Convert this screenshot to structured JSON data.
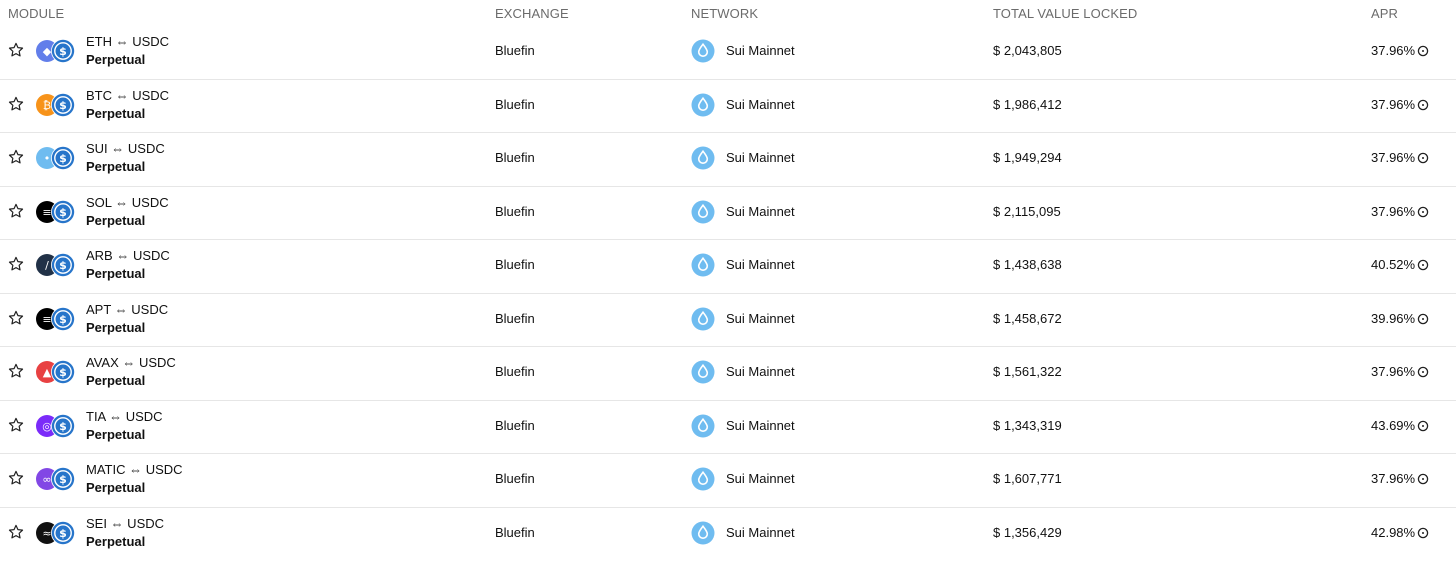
{
  "columns": {
    "module": "MODULE",
    "exchange": "EXCHANGE",
    "network": "NETWORK",
    "tvl": "TOTAL VALUE LOCKED",
    "apr": "APR"
  },
  "colors": {
    "usdc_blue": "#2775CA",
    "sui_blue": "#6FBCF0",
    "border": "#E6E6E6"
  },
  "icons": {
    "favorite": "star-outline-icon",
    "network": "sui-drop-icon",
    "apr_info": "info-circle-icon",
    "quote": "usdc-icon"
  },
  "rows": [
    {
      "pair": "ETH ⇔ USDC",
      "type": "Perpetual",
      "exchange": "Bluefin",
      "network": "Sui Mainnet",
      "tvl": "$ 2,043,805",
      "apr": "37.96%",
      "base_icon": "eth-icon",
      "base_color": "#627EEA"
    },
    {
      "pair": "BTC ⇔ USDC",
      "type": "Perpetual",
      "exchange": "Bluefin",
      "network": "Sui Mainnet",
      "tvl": "$ 1,986,412",
      "apr": "37.96%",
      "base_icon": "btc-icon",
      "base_color": "#F7931A"
    },
    {
      "pair": "SUI ⇔ USDC",
      "type": "Perpetual",
      "exchange": "Bluefin",
      "network": "Sui Mainnet",
      "tvl": "$ 1,949,294",
      "apr": "37.96%",
      "base_icon": "sui-icon",
      "base_color": "#6FBCF0"
    },
    {
      "pair": "SOL ⇔ USDC",
      "type": "Perpetual",
      "exchange": "Bluefin",
      "network": "Sui Mainnet",
      "tvl": "$ 2,115,095",
      "apr": "37.96%",
      "base_icon": "sol-icon",
      "base_color": "#000000"
    },
    {
      "pair": "ARB ⇔ USDC",
      "type": "Perpetual",
      "exchange": "Bluefin",
      "network": "Sui Mainnet",
      "tvl": "$ 1,438,638",
      "apr": "40.52%",
      "base_icon": "arb-icon",
      "base_color": "#213147"
    },
    {
      "pair": "APT ⇔ USDC",
      "type": "Perpetual",
      "exchange": "Bluefin",
      "network": "Sui Mainnet",
      "tvl": "$ 1,458,672",
      "apr": "39.96%",
      "base_icon": "apt-icon",
      "base_color": "#000000"
    },
    {
      "pair": "AVAX ⇔ USDC",
      "type": "Perpetual",
      "exchange": "Bluefin",
      "network": "Sui Mainnet",
      "tvl": "$ 1,561,322",
      "apr": "37.96%",
      "base_icon": "avax-icon",
      "base_color": "#E84142"
    },
    {
      "pair": "TIA ⇔ USDC",
      "type": "Perpetual",
      "exchange": "Bluefin",
      "network": "Sui Mainnet",
      "tvl": "$ 1,343,319",
      "apr": "43.69%",
      "base_icon": "tia-icon",
      "base_color": "#7B2BF9"
    },
    {
      "pair": "MATIC ⇔ USDC",
      "type": "Perpetual",
      "exchange": "Bluefin",
      "network": "Sui Mainnet",
      "tvl": "$ 1,607,771",
      "apr": "37.96%",
      "base_icon": "matic-icon",
      "base_color": "#8247E5"
    },
    {
      "pair": "SEI ⇔ USDC",
      "type": "Perpetual",
      "exchange": "Bluefin",
      "network": "Sui Mainnet",
      "tvl": "$ 1,356,429",
      "apr": "42.98%",
      "base_icon": "sei-icon",
      "base_color": "#111111"
    }
  ]
}
